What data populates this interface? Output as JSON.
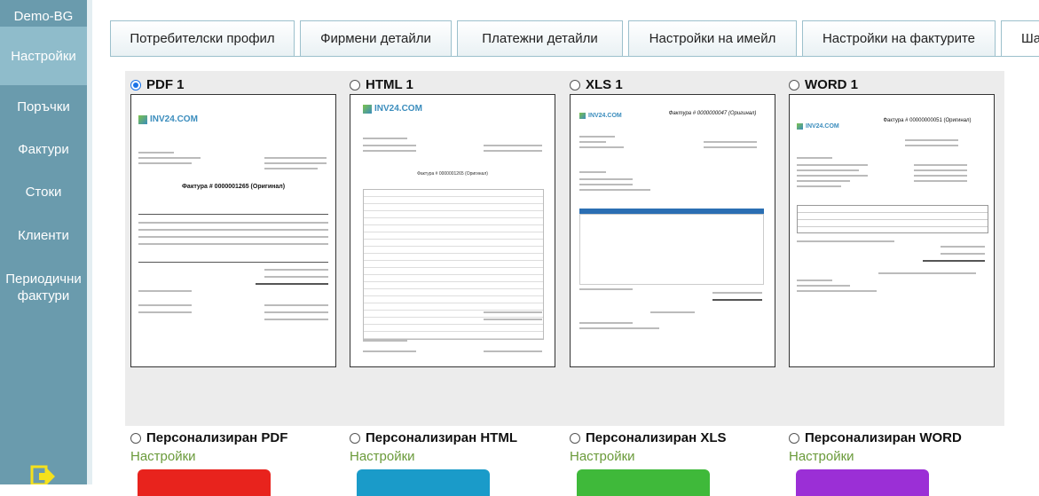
{
  "sidebar": {
    "brand": "Demo-BG",
    "items": [
      {
        "label": "Настройки",
        "active": true
      },
      {
        "label": "Поръчки"
      },
      {
        "label": "Фактури"
      },
      {
        "label": "Стоки"
      },
      {
        "label": "Клиенти"
      },
      {
        "label": "Периодични фактури"
      }
    ]
  },
  "tabs": [
    {
      "label": "Потребителски профил"
    },
    {
      "label": "Фирмени детайли"
    },
    {
      "label": "Платежни детайли"
    },
    {
      "label": "Настройки на имейл"
    },
    {
      "label": "Настройки на фактурите"
    },
    {
      "label": "Ша",
      "active": true
    }
  ],
  "templates": [
    {
      "label": "PDF 1",
      "selected": true,
      "logo": "INV24.COM",
      "title": "Фактура # 0000001265 (Оригинал)"
    },
    {
      "label": "HTML 1",
      "selected": false,
      "logo": "INV24.COM",
      "title": "Фактура # 0000001265 (Оригинал)"
    },
    {
      "label": "XLS 1",
      "selected": false,
      "logo": "INV24.COM",
      "title": "Фактура # 0000000047 (Оригинал)"
    },
    {
      "label": "WORD 1",
      "selected": false,
      "logo": "INV24.COM",
      "title": "Фактура # 00000000051 (Оригинал)"
    }
  ],
  "custom_templates": [
    {
      "label": "Персонализиран PDF",
      "settings": "Настройки",
      "color": "#e8231d"
    },
    {
      "label": "Персонализиран HTML",
      "settings": "Настройки",
      "color": "#1a9bc9"
    },
    {
      "label": "Персонализиран XLS",
      "settings": "Настройки",
      "color": "#3fb93a"
    },
    {
      "label": "Персонализиран WORD",
      "settings": "Настройки",
      "color": "#9b2fd6"
    }
  ]
}
